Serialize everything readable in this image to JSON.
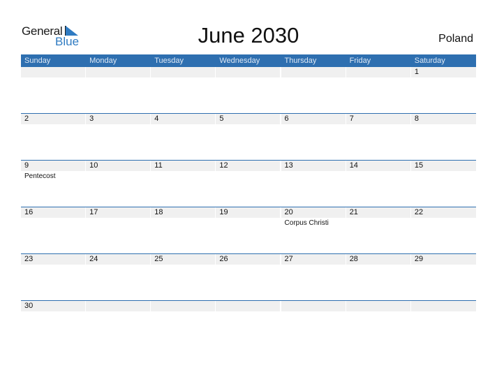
{
  "logo": {
    "general": "General",
    "blue": "Blue"
  },
  "title": "June 2030",
  "country": "Poland",
  "colors": {
    "accent": "#2e6fb0",
    "daybar": "#f0f0f0",
    "logo_blue": "#2f7bc2"
  },
  "weekdays": [
    "Sunday",
    "Monday",
    "Tuesday",
    "Wednesday",
    "Thursday",
    "Friday",
    "Saturday"
  ],
  "weeks": [
    [
      {
        "day": ""
      },
      {
        "day": ""
      },
      {
        "day": ""
      },
      {
        "day": ""
      },
      {
        "day": ""
      },
      {
        "day": ""
      },
      {
        "day": "1"
      }
    ],
    [
      {
        "day": "2"
      },
      {
        "day": "3"
      },
      {
        "day": "4"
      },
      {
        "day": "5"
      },
      {
        "day": "6"
      },
      {
        "day": "7"
      },
      {
        "day": "8"
      }
    ],
    [
      {
        "day": "9",
        "holiday": "Pentecost"
      },
      {
        "day": "10"
      },
      {
        "day": "11"
      },
      {
        "day": "12"
      },
      {
        "day": "13"
      },
      {
        "day": "14"
      },
      {
        "day": "15"
      }
    ],
    [
      {
        "day": "16"
      },
      {
        "day": "17"
      },
      {
        "day": "18"
      },
      {
        "day": "19"
      },
      {
        "day": "20",
        "holiday": "Corpus Christi"
      },
      {
        "day": "21"
      },
      {
        "day": "22"
      }
    ],
    [
      {
        "day": "23"
      },
      {
        "day": "24"
      },
      {
        "day": "25"
      },
      {
        "day": "26"
      },
      {
        "day": "27"
      },
      {
        "day": "28"
      },
      {
        "day": "29"
      }
    ],
    [
      {
        "day": "30"
      },
      {
        "day": ""
      },
      {
        "day": ""
      },
      {
        "day": ""
      },
      {
        "day": ""
      },
      {
        "day": ""
      },
      {
        "day": ""
      }
    ]
  ]
}
